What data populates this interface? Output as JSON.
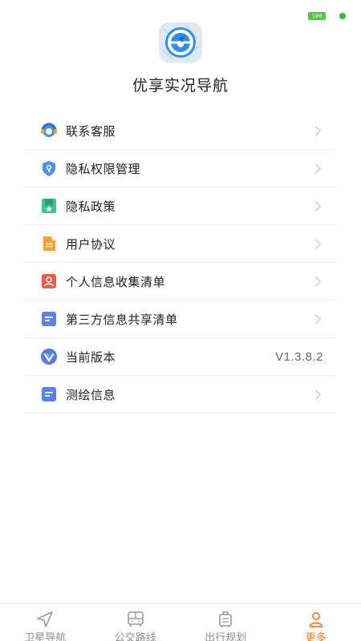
{
  "status_bar": {
    "battery_text": "100"
  },
  "app": {
    "title": "优享实况导航"
  },
  "menu": {
    "items": [
      {
        "label": "联系客服",
        "icon": "customer-service-icon"
      },
      {
        "label": "隐私权限管理",
        "icon": "privacy-shield-icon"
      },
      {
        "label": "隐私政策",
        "icon": "policy-icon"
      },
      {
        "label": "用户协议",
        "icon": "user-agreement-icon"
      },
      {
        "label": "个人信息收集清单",
        "icon": "personal-info-icon"
      },
      {
        "label": "第三方信息共享清单",
        "icon": "third-party-share-icon"
      },
      {
        "label": "当前版本",
        "icon": "version-icon",
        "value": "V1.3.8.2"
      },
      {
        "label": "测绘信息",
        "icon": "survey-info-icon"
      }
    ]
  },
  "tabs": [
    {
      "label": "卫星导航",
      "icon": "navigation-arrow-icon",
      "active": false
    },
    {
      "label": "公交路线",
      "icon": "bus-icon",
      "active": false
    },
    {
      "label": "出行规划",
      "icon": "travel-plan-icon",
      "active": false
    },
    {
      "label": "更多",
      "icon": "person-icon",
      "active": true
    }
  ],
  "colors": {
    "accent": "#f07a2e",
    "inactive_tab": "#8e8e8e",
    "logo_blue": "#2d8fe6"
  }
}
